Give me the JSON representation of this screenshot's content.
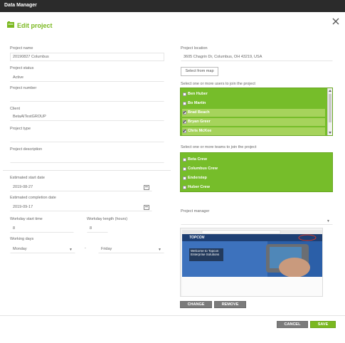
{
  "window": {
    "title": "Data Manager"
  },
  "header": {
    "title": "Edit project",
    "icon": "edit-icon"
  },
  "left": {
    "project_name": {
      "label": "Project name",
      "value": "20190827 Columbus"
    },
    "project_status": {
      "label": "Project status",
      "value": "Active"
    },
    "project_number": {
      "label": "Project number",
      "value": ""
    },
    "client": {
      "label": "Client",
      "value": "BetaAITestGROUP"
    },
    "project_type": {
      "label": "Project type",
      "value": ""
    },
    "project_description": {
      "label": "Project description",
      "value": ""
    },
    "start_date": {
      "label": "Estimated start date",
      "value": "2019-08-27"
    },
    "completion_date": {
      "label": "Estimated completion date",
      "value": "2019-09-17"
    },
    "workday_start": {
      "label": "Workday start time",
      "value": "8"
    },
    "workday_length": {
      "label": "Workday length (hours)",
      "value": "8"
    },
    "working_days": {
      "label": "Working days",
      "from": "Monday",
      "separator": "-",
      "to": "Friday"
    }
  },
  "right": {
    "location": {
      "label": "Project location",
      "value": "3605 Chagrin Dr, Columbus, OH 43219, USA"
    },
    "select_from_map": "Select from map",
    "users_label": "Select one or more users to join the project",
    "users": [
      {
        "name": "Ben Huber",
        "checked": false,
        "selected": false
      },
      {
        "name": "Bo Martin",
        "checked": false,
        "selected": false
      },
      {
        "name": "Brad Beach",
        "checked": true,
        "selected": true
      },
      {
        "name": "Bryan Greer",
        "checked": true,
        "selected": true
      },
      {
        "name": "Chris McKee",
        "checked": true,
        "selected": true
      }
    ],
    "teams_label": "Select one or more teams to join the project",
    "teams": [
      {
        "name": "Beta Crew",
        "checked": false
      },
      {
        "name": "Columbus Crew",
        "checked": false
      },
      {
        "name": "Enderstep",
        "checked": false
      },
      {
        "name": "Huber Crew",
        "checked": false
      }
    ],
    "manager_label": "Project manager",
    "manager_value": "",
    "thumbnail": {
      "brand": "TOPCON",
      "headline": "Welcome to Topcon Enterprise Solutions"
    },
    "change_button": "CHANGE",
    "remove_button": "REMOVE"
  },
  "footer": {
    "cancel": "CANCEL",
    "save": "SAVE"
  },
  "colors": {
    "accent": "#7ab81f",
    "list_bg": "#76bd2a",
    "titlebar": "#2b2b2b"
  }
}
